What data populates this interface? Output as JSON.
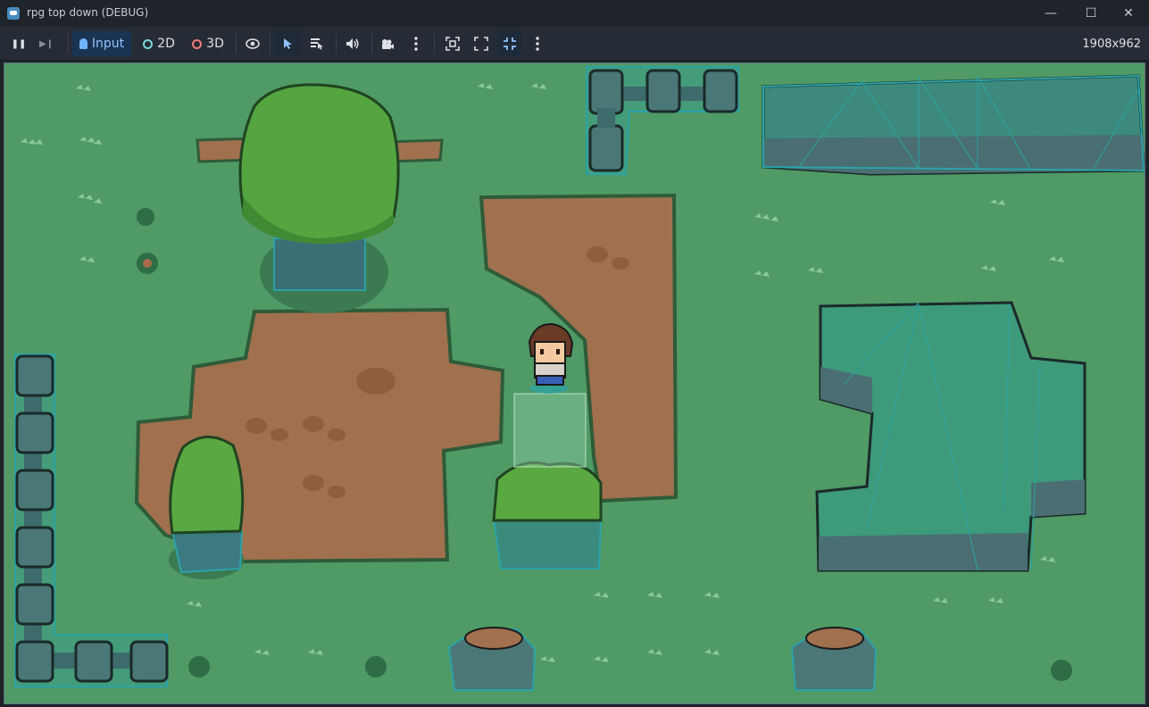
{
  "window": {
    "title": "rpg top down (DEBUG)",
    "minimize_glyph": "—",
    "maximize_glyph": "☐",
    "close_glyph": "✕"
  },
  "toolbar": {
    "pause_glyph": "❚❚",
    "step_glyph": "▶❙",
    "input_label": "Input",
    "mode_2d_label": "2D",
    "mode_3d_label": "3D",
    "viewport_size": "1908x962"
  },
  "colors": {
    "grass": "#4f9a65",
    "dirt": "#a0704f",
    "collision_teal": "#2ba3a8",
    "accent": "#478cbf"
  },
  "scene": {
    "player": "player-sprite",
    "objects": [
      "tree",
      "bush",
      "stone-fence",
      "cliff",
      "stump",
      "dirt-path",
      "grass-tuft"
    ]
  }
}
